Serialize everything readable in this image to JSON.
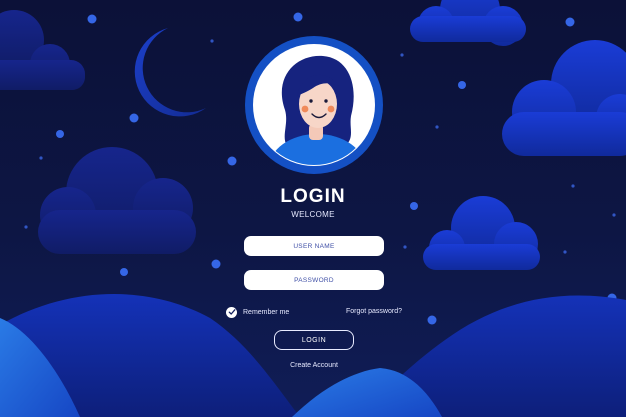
{
  "form": {
    "title": "LOGIN",
    "subtitle": "WELCOME",
    "username_placeholder": "USER NAME",
    "password_placeholder": "PASSWORD",
    "remember_label": "Remember me",
    "remember_checked": true,
    "forgot_label": "Forgot password?",
    "login_button": "LOGIN",
    "create_account": "Create Account"
  },
  "colors": {
    "background_top": "#0c1138",
    "background_bottom": "#101d57",
    "accent_blue": "#1b3ee6",
    "avatar_ring": "#1450c4",
    "hair": "#16237f",
    "field_bg": "#ffffff"
  },
  "icons": [
    "moon-icon",
    "checkmark-icon"
  ]
}
